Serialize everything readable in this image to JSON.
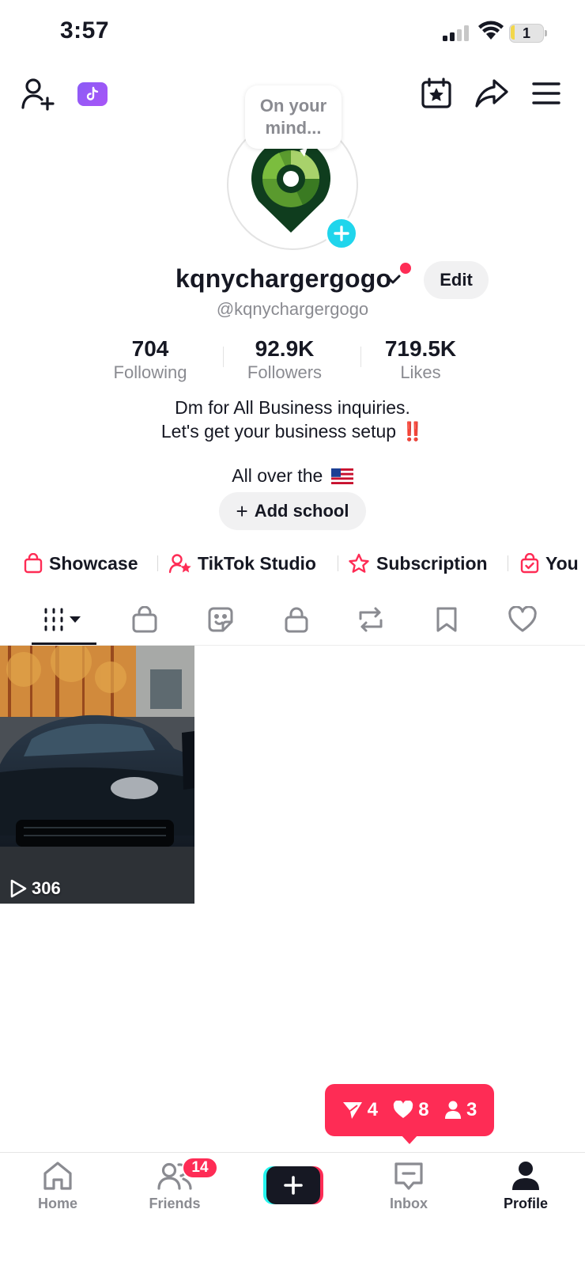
{
  "status_bar": {
    "time": "3:57",
    "battery_level": "1"
  },
  "profile": {
    "thought_bubble": "On your mind...",
    "username": "kqnychargergogo",
    "handle": "@kqnychargergogo",
    "edit_label": "Edit",
    "stats": [
      {
        "value": "704",
        "label": "Following"
      },
      {
        "value": "92.9K",
        "label": "Followers"
      },
      {
        "value": "719.5K",
        "label": "Likes"
      }
    ],
    "bio": {
      "line1": "Dm for All Business inquiries.",
      "line2": "Let's get your business setup",
      "line2_mark": "‼️",
      "location": "All over the"
    },
    "add_school_label": "Add school"
  },
  "quick_links": [
    {
      "label": "Showcase",
      "icon": "shopping-bag-icon"
    },
    {
      "label": "TikTok Studio",
      "icon": "creator-star-icon"
    },
    {
      "label": "Subscription",
      "icon": "subscription-star-icon"
    },
    {
      "label": "You",
      "icon": "order-bag-icon"
    }
  ],
  "tabs": [
    {
      "name": "videos",
      "icon": "grid-icon",
      "active": true
    },
    {
      "name": "shop",
      "icon": "shopping-bag-icon"
    },
    {
      "name": "stickers",
      "icon": "sticker-icon"
    },
    {
      "name": "private",
      "icon": "lock-icon"
    },
    {
      "name": "reposts",
      "icon": "repost-icon"
    },
    {
      "name": "saved",
      "icon": "bookmark-icon"
    },
    {
      "name": "liked",
      "icon": "heart-icon"
    }
  ],
  "videos": [
    {
      "views": "306"
    }
  ],
  "activity": {
    "comments": "4",
    "likes": "8",
    "followers": "3"
  },
  "bottom_nav": {
    "items": [
      {
        "label": "Home"
      },
      {
        "label": "Friends",
        "badge": "14"
      },
      {
        "label": "Inbox"
      },
      {
        "label": "Profile",
        "active": true
      }
    ]
  },
  "colors": {
    "accent": "#fe2c55",
    "cyan": "#25f4ee",
    "text": "#161823",
    "muted": "#8a8b91"
  }
}
